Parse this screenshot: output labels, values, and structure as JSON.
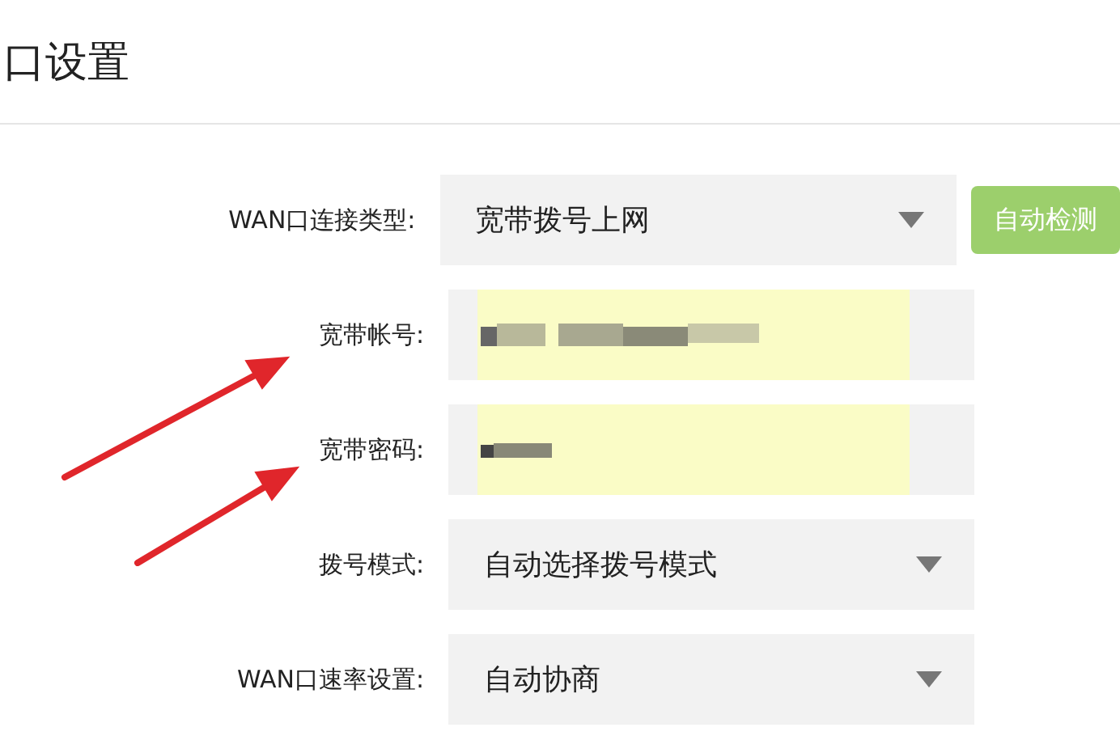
{
  "page_title": "口设置",
  "fields": [
    {
      "label": "WAN口连接类型:",
      "kind": "select",
      "value": "宽带拨号上网",
      "button": "自动检测"
    },
    {
      "label": "宽带帐号:",
      "kind": "input",
      "autofilled": true
    },
    {
      "label": "宽带密码:",
      "kind": "input",
      "autofilled": true
    },
    {
      "label": "拨号模式:",
      "kind": "select",
      "value": "自动选择拨号模式"
    },
    {
      "label": "WAN口速率设置:",
      "kind": "select",
      "value": "自动协商"
    }
  ]
}
